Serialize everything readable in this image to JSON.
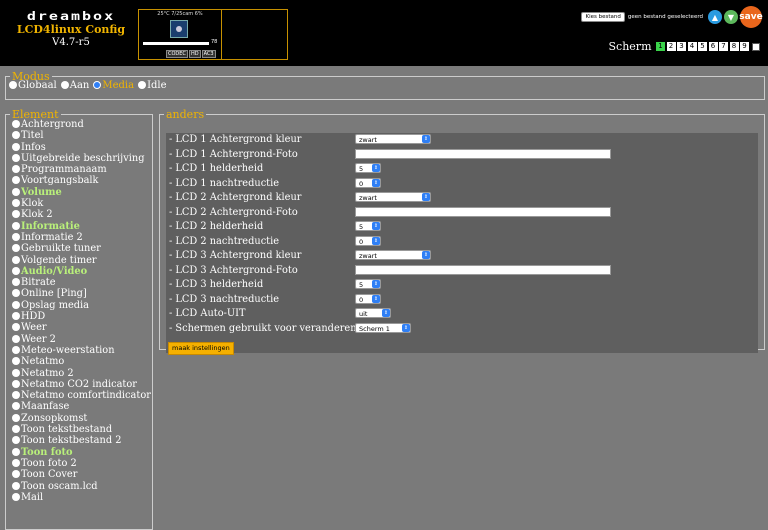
{
  "app": {
    "logo_word": "dreambox",
    "title": "LCD4linux Config",
    "version": "V4.7-r5"
  },
  "preview": {
    "top_text": "25°C 7/25cam 6%",
    "bar_value": "78",
    "bar_fill_fraction": 1.0,
    "icons": [
      "CODEC",
      "HD",
      "AC3"
    ]
  },
  "toolbar": {
    "choose_file_label": "Kies bestand",
    "no_file_text": "geen bestand geselecteerd",
    "save_label": "save",
    "icons": [
      "upload-icon",
      "download-icon",
      "save-icon"
    ]
  },
  "screens": {
    "label": "Scherm",
    "buttons": [
      "1",
      "2",
      "3",
      "4",
      "5",
      "6",
      "7",
      "8",
      "9"
    ],
    "active_index": 0
  },
  "modus": {
    "legend": "Modus",
    "options": [
      "Globaal",
      "Aan",
      "Media",
      "Idle"
    ],
    "selected": "Media"
  },
  "element": {
    "legend": "Element",
    "items": [
      {
        "label": "Achtergrond",
        "highlight": false
      },
      {
        "label": "Titel",
        "highlight": false
      },
      {
        "label": "Infos",
        "highlight": false
      },
      {
        "label": "Uitgebreide beschrijving",
        "highlight": false
      },
      {
        "label": "Programmanaam",
        "highlight": false
      },
      {
        "label": "Voortgangsbalk",
        "highlight": false
      },
      {
        "label": "Volume",
        "highlight": true
      },
      {
        "label": "Klok",
        "highlight": false
      },
      {
        "label": "Klok 2",
        "highlight": false
      },
      {
        "label": "Informatie",
        "highlight": true
      },
      {
        "label": "Informatie 2",
        "highlight": false
      },
      {
        "label": "Gebruikte tuner",
        "highlight": false
      },
      {
        "label": "Volgende timer",
        "highlight": false
      },
      {
        "label": "Audio/Video",
        "highlight": true
      },
      {
        "label": "Bitrate",
        "highlight": false
      },
      {
        "label": "Online [Ping]",
        "highlight": false
      },
      {
        "label": "Opslag media",
        "highlight": false
      },
      {
        "label": "HDD",
        "highlight": false
      },
      {
        "label": "Weer",
        "highlight": false
      },
      {
        "label": "Weer 2",
        "highlight": false
      },
      {
        "label": "Meteo-weerstation",
        "highlight": false
      },
      {
        "label": "Netatmo",
        "highlight": false
      },
      {
        "label": "Netatmo 2",
        "highlight": false
      },
      {
        "label": "Netatmo CO2 indicator",
        "highlight": false
      },
      {
        "label": "Netatmo comfortindicator",
        "highlight": false
      },
      {
        "label": "Maanfase",
        "highlight": false
      },
      {
        "label": "Zonsopkomst",
        "highlight": false
      },
      {
        "label": "Toon tekstbestand",
        "highlight": false
      },
      {
        "label": "Toon tekstbestand 2",
        "highlight": false
      },
      {
        "label": "Toon foto",
        "highlight": true
      },
      {
        "label": "Toon foto 2",
        "highlight": false
      },
      {
        "label": "Toon Cover",
        "highlight": false
      },
      {
        "label": "Toon oscam.lcd",
        "highlight": false
      },
      {
        "label": "Mail",
        "highlight": false
      }
    ]
  },
  "anders": {
    "legend": "anders",
    "rows": [
      {
        "label": "- LCD 1 Achtergrond kleur",
        "type": "select",
        "value": "zwart",
        "width": "w76"
      },
      {
        "label": "- LCD 1 Achtergrond-Foto",
        "type": "text",
        "value": ""
      },
      {
        "label": "- LCD 1 helderheid",
        "type": "select",
        "value": "5",
        "width": "w26"
      },
      {
        "label": "- LCD 1 nachtreductie",
        "type": "select",
        "value": "0",
        "width": "w26"
      },
      {
        "label": "- LCD 2 Achtergrond kleur",
        "type": "select",
        "value": "zwart",
        "width": "w76"
      },
      {
        "label": "- LCD 2 Achtergrond-Foto",
        "type": "text",
        "value": ""
      },
      {
        "label": "- LCD 2 helderheid",
        "type": "select",
        "value": "5",
        "width": "w26"
      },
      {
        "label": "- LCD 2 nachtreductie",
        "type": "select",
        "value": "0",
        "width": "w26"
      },
      {
        "label": "- LCD 3 Achtergrond kleur",
        "type": "select",
        "value": "zwart",
        "width": "w76"
      },
      {
        "label": "- LCD 3 Achtergrond-Foto",
        "type": "text",
        "value": ""
      },
      {
        "label": "- LCD 3 helderheid",
        "type": "select",
        "value": "5",
        "width": "w26"
      },
      {
        "label": "- LCD 3 nachtreductie",
        "type": "select",
        "value": "0",
        "width": "w26"
      },
      {
        "label": "- LCD Auto-UIT",
        "type": "select",
        "value": "uit",
        "width": "w36"
      },
      {
        "label": "- Schermen gebruikt voor veranderen",
        "type": "select",
        "value": "Scherm 1",
        "width": "w56"
      }
    ],
    "submit_label": "maak instellingen"
  },
  "colors": {
    "accent": "#f0b400",
    "highlight_text": "#b9f07a",
    "active_screen": "#3ad24a",
    "radio_selected": "#2f7ff5",
    "save_orange": "#e9661c"
  }
}
